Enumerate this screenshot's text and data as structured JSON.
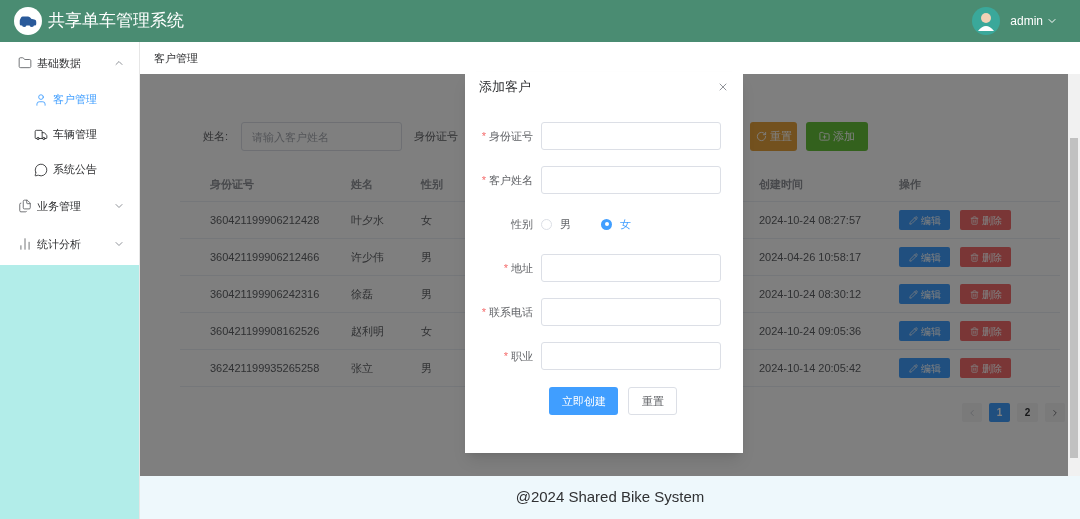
{
  "header": {
    "title": "共享单车管理系统",
    "user": "admin"
  },
  "sidebar": [
    {
      "label": "基础数据",
      "expanded": true,
      "children": [
        {
          "label": "客户管理",
          "selected": true
        },
        {
          "label": "车辆管理",
          "selected": false
        },
        {
          "label": "系统公告",
          "selected": false
        }
      ]
    },
    {
      "label": "业务管理",
      "expanded": false
    },
    {
      "label": "统计分析",
      "expanded": false
    }
  ],
  "breadcrumb": "客户管理",
  "filters": [
    {
      "label": "姓名:",
      "placeholder": "请输入客户姓名"
    },
    {
      "label": "身份证号"
    }
  ],
  "toolbar": [
    {
      "kind": "reset",
      "label": "重置"
    },
    {
      "kind": "add",
      "label": "添加"
    }
  ],
  "table": {
    "columns": [
      "身份证号",
      "姓名",
      "性别",
      "创建时间",
      "操作"
    ],
    "rows": [
      {
        "id": "360421199906212428",
        "name": "叶夕水",
        "gender": "女",
        "created": "2024-10-24 08:27:57",
        "actions": [
          "编辑",
          "删除"
        ]
      },
      {
        "id": "360421199906212466",
        "name": "许少伟",
        "gender": "男",
        "created": "2024-04-26 10:58:17",
        "actions": [
          "编辑",
          "删除"
        ]
      },
      {
        "id": "360421199906242316",
        "name": "徐磊",
        "gender": "男",
        "created": "2024-10-24 08:30:12",
        "actions": [
          "编辑",
          "删除"
        ]
      },
      {
        "id": "360421199908162526",
        "name": "赵利明",
        "gender": "女",
        "created": "2024-10-24 09:05:36",
        "actions": [
          "编辑",
          "删除"
        ]
      },
      {
        "id": "362421199935265258",
        "name": "张立",
        "gender": "男",
        "created": "2024-10-14 20:05:42",
        "actions": [
          "编辑",
          "删除"
        ]
      }
    ]
  },
  "pagination": [
    {
      "label": "1",
      "selected": true
    },
    {
      "label": "2",
      "selected": false
    }
  ],
  "dialog": {
    "title": "添加客户",
    "fields": [
      {
        "kind": "text",
        "mark": "*",
        "label": "身份证号"
      },
      {
        "kind": "text",
        "mark": "*",
        "label": "客户姓名"
      },
      {
        "kind": "radio",
        "label": "性别",
        "options": [
          {
            "label": "男",
            "selected": false
          },
          {
            "label": "女",
            "selected": true
          }
        ]
      },
      {
        "kind": "text",
        "mark": "*",
        "label": "地址"
      },
      {
        "kind": "text",
        "mark": "*",
        "label": "联系电话"
      },
      {
        "kind": "text",
        "mark": "*",
        "label": "职业"
      }
    ],
    "buttons": [
      {
        "kind": "primary",
        "label": "立即创建"
      },
      {
        "kind": "default",
        "label": "重置"
      }
    ]
  },
  "footer": "@2024 Shared Bike System"
}
